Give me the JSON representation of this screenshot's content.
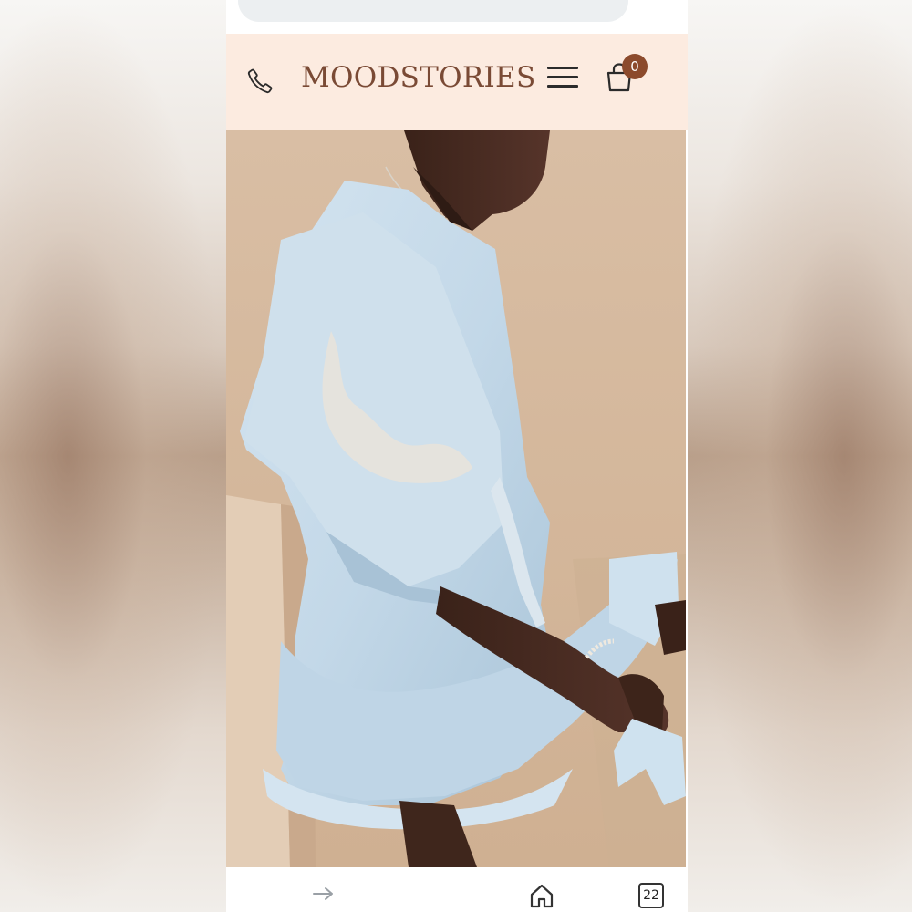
{
  "header": {
    "brand": "MOODSTORIES",
    "cart_count": "0",
    "background_color": "#fcebe0",
    "brand_color": "#7a4a35",
    "badge_color": "#8c4a2c"
  },
  "icons": {
    "phone": "phone-icon",
    "menu": "hamburger-menu-icon",
    "cart": "shopping-bag-icon",
    "forward": "forward-arrow-icon",
    "home": "home-icon",
    "tabs": "tabs-icon"
  },
  "hero": {
    "subject": "model wearing light blue embroidered mini dress",
    "dress_color": "#c9dceb"
  },
  "browser": {
    "tabs_count": "22"
  }
}
